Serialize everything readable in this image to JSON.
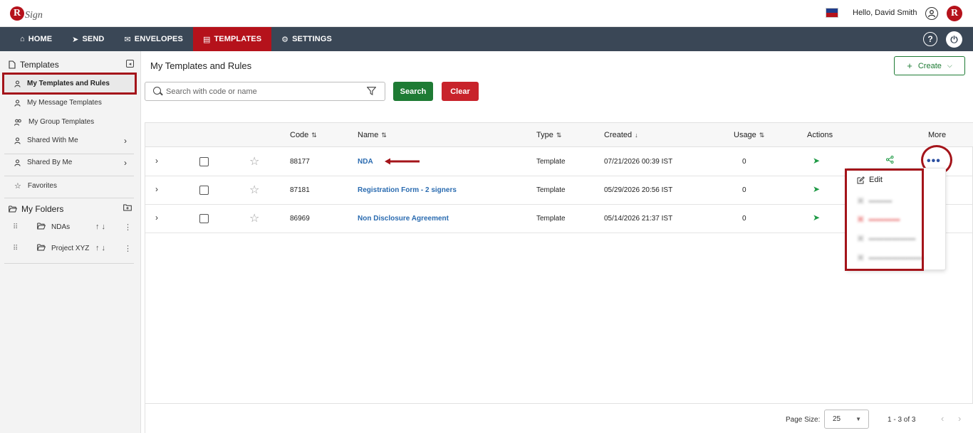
{
  "header": {
    "logo_letter": "R",
    "logo_text": "Sign",
    "greeting": "Hello, David Smith",
    "avatar_letter": "R"
  },
  "nav": {
    "items": [
      {
        "icon": "⌂",
        "label": "HOME"
      },
      {
        "icon": "➤",
        "label": "SEND"
      },
      {
        "icon": "✉",
        "label": "ENVELOPES"
      },
      {
        "icon": "▤",
        "label": "TEMPLATES"
      },
      {
        "icon": "⚙",
        "label": "SETTINGS"
      }
    ],
    "active": "TEMPLATES",
    "help": "?",
    "power": "⏻"
  },
  "sidebar": {
    "heading": "Templates",
    "items": [
      {
        "label": "My Templates and Rules"
      },
      {
        "label": "My Message Templates"
      },
      {
        "label": "My Group Templates"
      },
      {
        "label": "Shared With Me"
      },
      {
        "label": "Shared By Me"
      },
      {
        "label": "Favorites"
      }
    ],
    "folders_heading": "My Folders",
    "folders": [
      {
        "name": "NDAs"
      },
      {
        "name": "Project XYZ"
      }
    ]
  },
  "main": {
    "title": "My Templates and Rules",
    "create_label": "Create",
    "search_placeholder": "Search with code or name",
    "search_button": "Search",
    "clear_button": "Clear"
  },
  "table": {
    "columns": {
      "code": "Code",
      "name": "Name",
      "type": "Type",
      "created": "Created",
      "usage": "Usage",
      "actions": "Actions",
      "more": "More"
    },
    "rows": [
      {
        "code": "88177",
        "name": "NDA",
        "type": "Template",
        "created": "07/21/2026 00:39 IST",
        "usage": "0"
      },
      {
        "code": "87181",
        "name": "Registration Form - 2 signers",
        "type": "Template",
        "created": "05/29/2026 20:56 IST",
        "usage": "0"
      },
      {
        "code": "86969",
        "name": "Non Disclosure Agreement",
        "type": "Template",
        "created": "05/14/2026 21:37 IST",
        "usage": "0"
      }
    ]
  },
  "pager": {
    "page_size_label": "Page Size:",
    "page_size": "25",
    "info": "1 - 3 of 3"
  },
  "more_menu": {
    "items": [
      {
        "label": "Edit"
      }
    ]
  },
  "colors": {
    "brand_red": "#b5121b",
    "nav_bg": "#3a4756",
    "green": "#1e7b34",
    "annotation": "#a4141a",
    "link_blue": "#2a6bb0"
  }
}
